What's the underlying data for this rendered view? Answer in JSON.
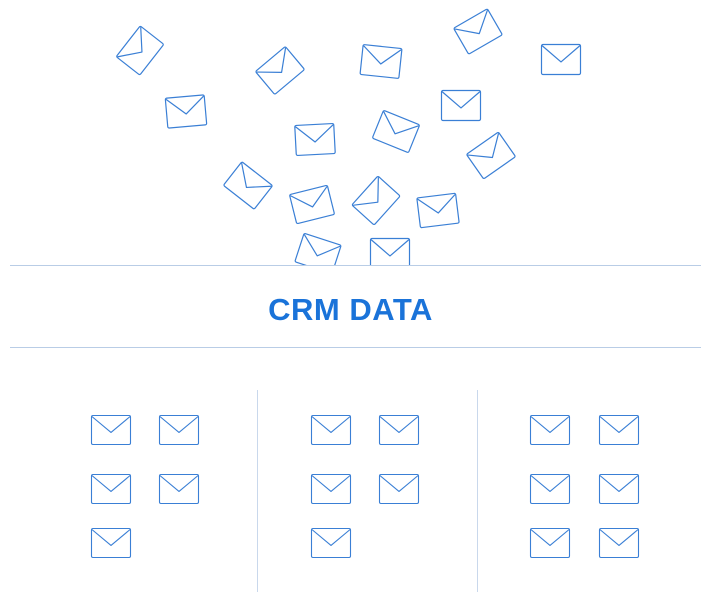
{
  "title": "CRM DATA",
  "icon": "envelope-icon",
  "colors": {
    "accent": "#1a73d9",
    "envelope_stroke": "#3a7fd5",
    "divider": "#b9cde6",
    "column_divider": "#c9d8ec",
    "background": "#ffffff"
  },
  "groups": [
    {
      "envelopes": 5
    },
    {
      "envelopes": 5
    },
    {
      "envelopes": 6
    }
  ]
}
